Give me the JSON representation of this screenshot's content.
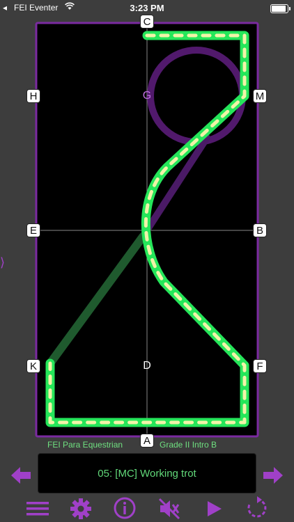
{
  "status_bar": {
    "back_glyph": "◂",
    "carrier": "FEI Eventer",
    "time": "3:23 PM"
  },
  "arena": {
    "letters": {
      "top": "C",
      "bottom": "A",
      "left_upper": "H",
      "left_middle": "E",
      "left_lower": "K",
      "right_upper": "M",
      "right_middle": "B",
      "right_lower": "F",
      "center_upper": "G",
      "center_lower": "D"
    },
    "colors": {
      "border": "#7a2aa0",
      "track": "#25e65a",
      "dashes": "#f1f4a8",
      "previous_track": "#5a1c78",
      "faded_track": "#1f5a2e"
    }
  },
  "side_handle": "⟩",
  "test": {
    "organization": "FEI Para Equestrian",
    "level": "Grade II Intro B"
  },
  "movement": {
    "text": "05: [MC] Working trot"
  },
  "toolbar": {
    "items": [
      "menu-icon",
      "gear-icon",
      "info-icon",
      "mute-icon",
      "play-icon",
      "replay-icon"
    ],
    "accent": "#a040c8"
  }
}
